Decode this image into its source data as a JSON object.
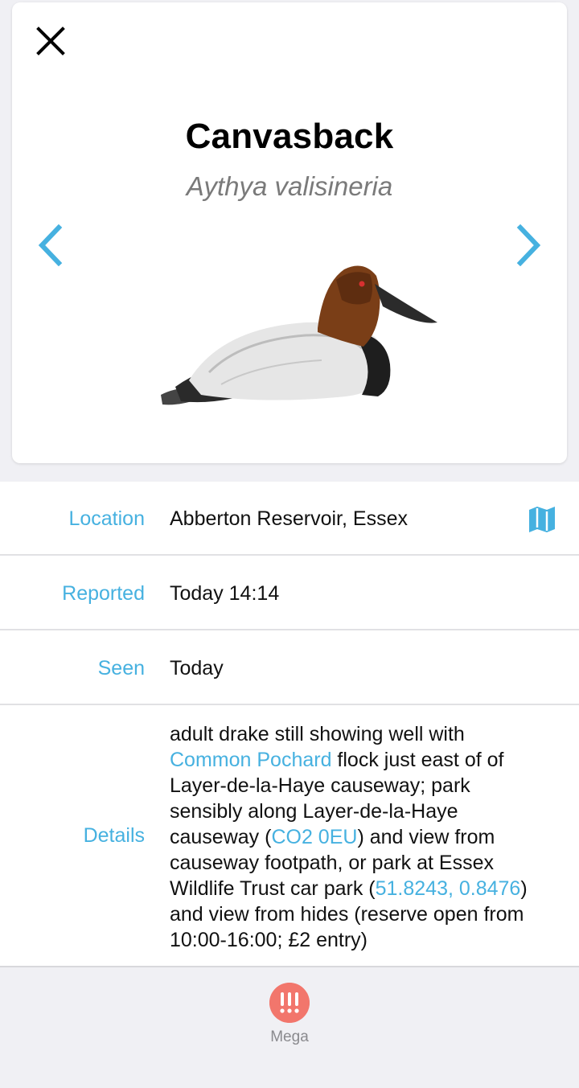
{
  "species": {
    "common_name": "Canvasback",
    "scientific_name": "Aythya valisineria",
    "image_icon": "duck-illustration"
  },
  "icons": {
    "close": "close-icon",
    "prev": "chevron-left-icon",
    "next": "chevron-right-icon",
    "map": "map-icon",
    "alert": "triple-exclamation-icon"
  },
  "colors": {
    "accent": "#46b1e0",
    "mega": "#f2766c",
    "background": "#f0f0f4"
  },
  "details": {
    "location_label": "Location",
    "location_value": "Abberton Reservoir, Essex",
    "reported_label": "Reported",
    "reported_value": "Today 14:14",
    "seen_label": "Seen",
    "seen_value": "Today",
    "details_label": "Details",
    "text": {
      "p1": "adult drake still showing well with",
      "link1": "Common Pochard",
      "p2": " flock just east of of Layer-de-la-Haye causeway; park sensibly along Layer-de-la-Haye causeway (",
      "link2": "CO2 0EU",
      "p3": ") and view from causeway footpath, or park at Essex Wildlife Trust car park (",
      "link3": "51.8243, 0.8476",
      "p4": ") and view from hides (reserve open from 10:00-16:00; £2 entry)"
    }
  },
  "footer": {
    "badge_label": "Mega"
  }
}
